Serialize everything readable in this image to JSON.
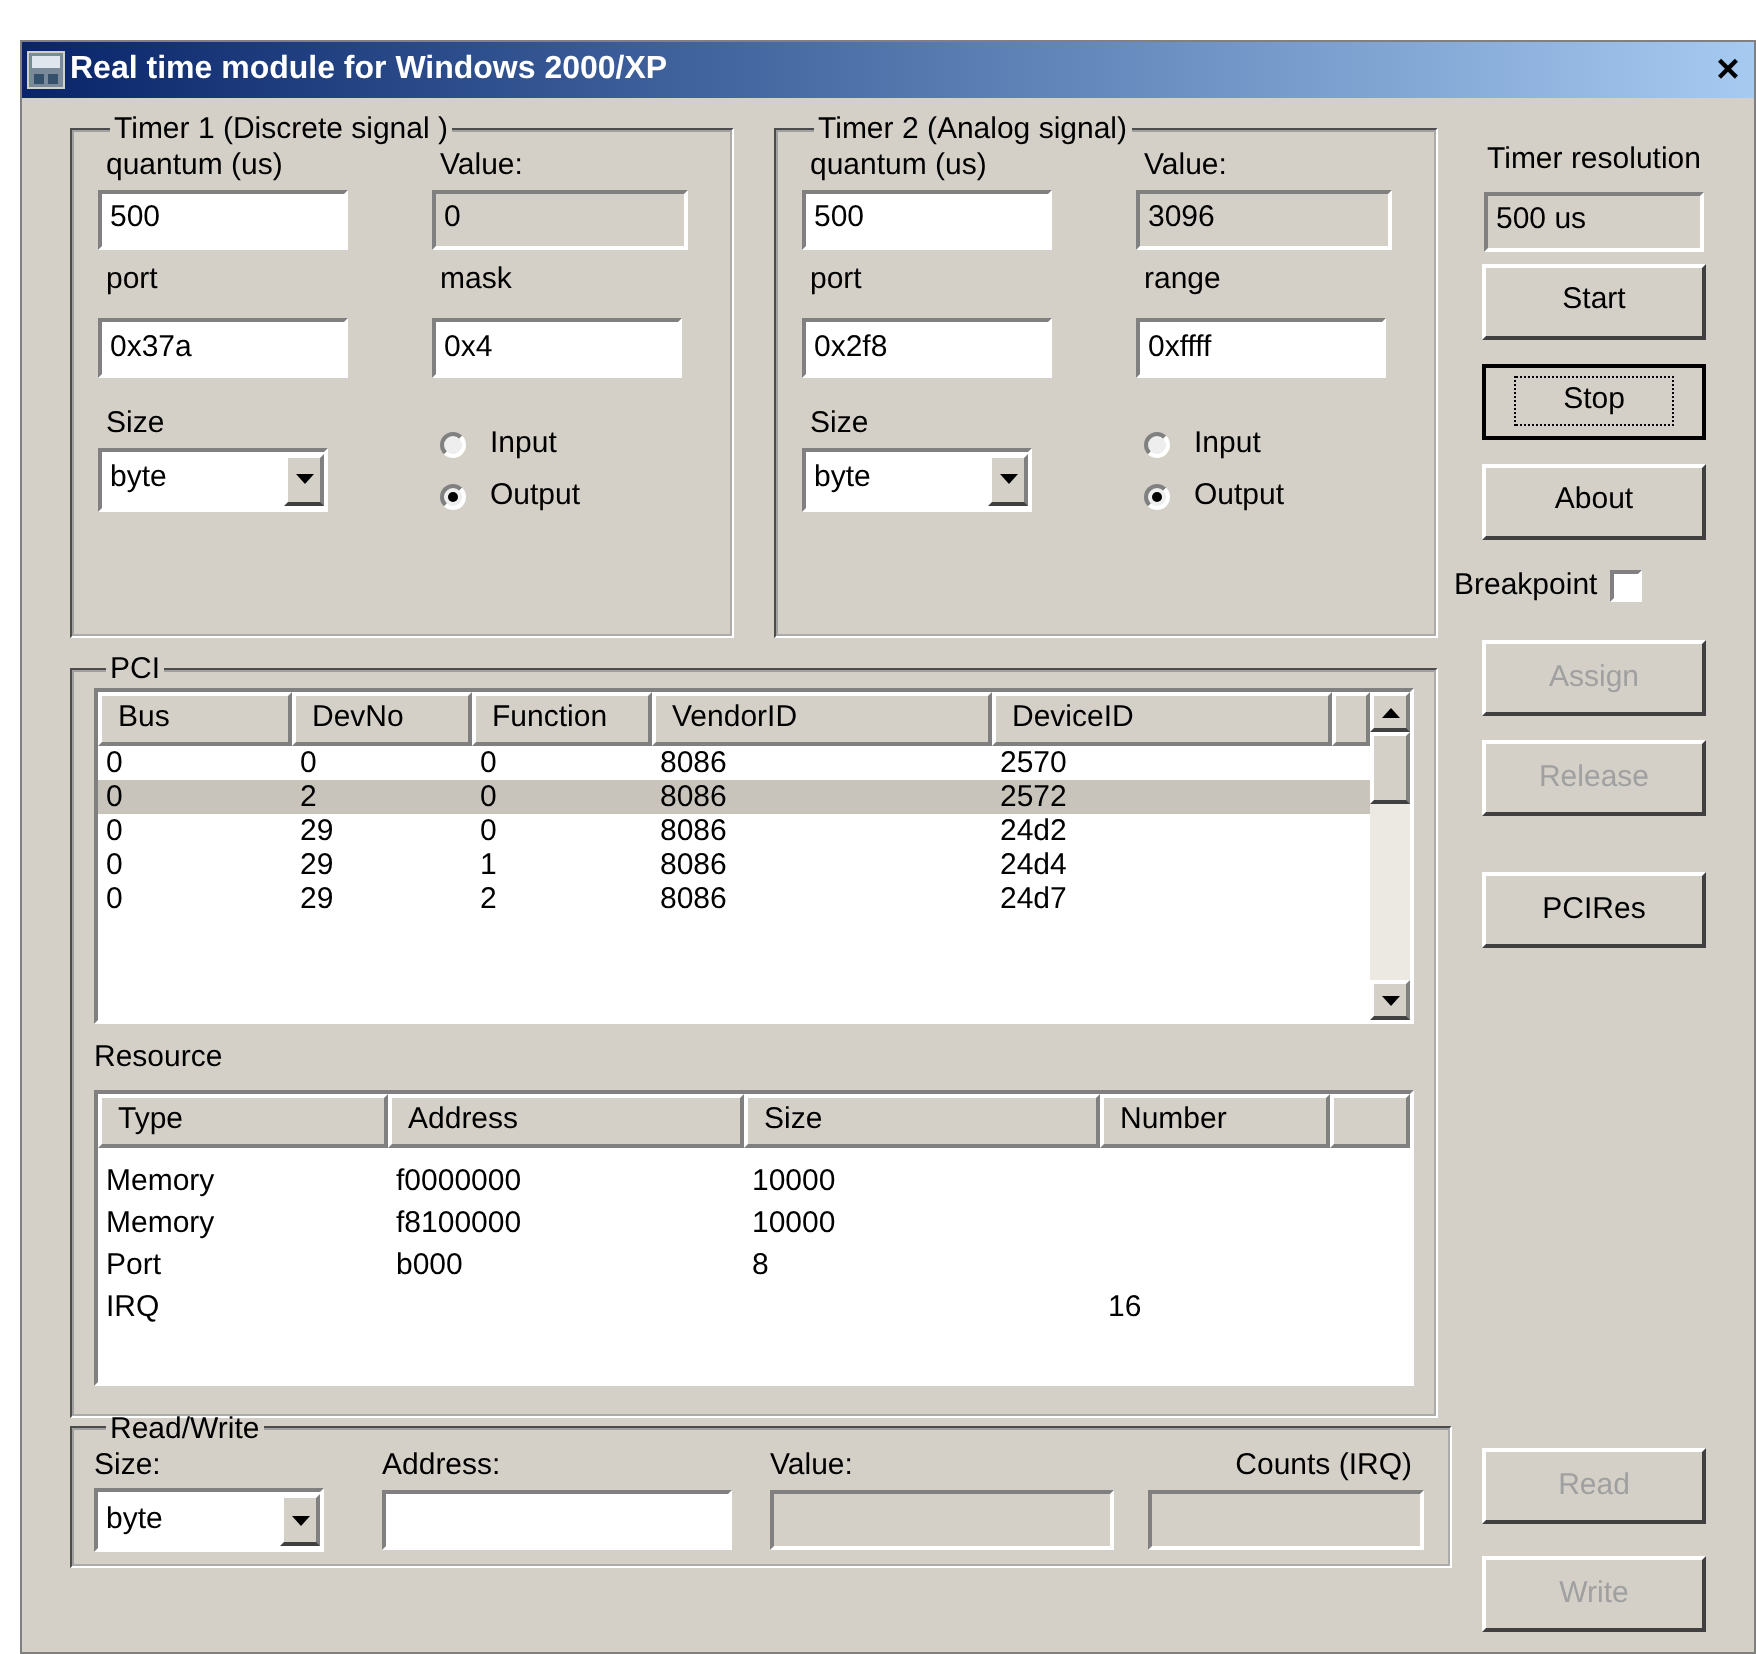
{
  "window": {
    "title": "Real time module for Windows 2000/XP",
    "close": "×"
  },
  "timers": [
    {
      "title": "Timer 1 (Discrete signal )",
      "quantum_label": "quantum (us)",
      "quantum": "500",
      "value_label": "Value:",
      "value": "0",
      "port_label": "port",
      "port": "0x37a",
      "extra_label": "mask",
      "extra": "0x4",
      "size_label": "Size",
      "size": "byte",
      "radios": [
        {
          "label": "Input",
          "selected": false
        },
        {
          "label": "Output",
          "selected": true
        }
      ]
    },
    {
      "title": "Timer 2 (Analog signal)",
      "quantum_label": "quantum (us)",
      "quantum": "500",
      "value_label": "Value:",
      "value": "3096",
      "port_label": "port",
      "port": "0x2f8",
      "extra_label": "range",
      "extra": "0xffff",
      "size_label": "Size",
      "size": "byte",
      "radios": [
        {
          "label": "Input",
          "selected": false
        },
        {
          "label": "Output",
          "selected": true
        }
      ]
    }
  ],
  "timer_resolution": {
    "label": "Timer resolution",
    "value": "500 us"
  },
  "top_buttons": [
    {
      "label": "Start",
      "disabled": false,
      "focused": false
    },
    {
      "label": "Stop",
      "disabled": false,
      "focused": true
    },
    {
      "label": "About",
      "disabled": false,
      "focused": false
    }
  ],
  "breakpoint": {
    "label": "Breakpoint",
    "checked": false
  },
  "pci_buttons": [
    {
      "label": "Assign",
      "disabled": true,
      "focused": false
    },
    {
      "label": "Release",
      "disabled": true,
      "focused": false
    },
    {
      "label": "PCIRes",
      "disabled": false,
      "focused": false
    }
  ],
  "pci": {
    "title": "PCI",
    "columns": [
      "Bus",
      "DevNo",
      "Function",
      "VendorID",
      "DeviceID"
    ],
    "rows": [
      {
        "cells": [
          "0",
          "0",
          "0",
          "8086",
          "2570"
        ],
        "selected": false
      },
      {
        "cells": [
          "0",
          "2",
          "0",
          "8086",
          "2572"
        ],
        "selected": true
      },
      {
        "cells": [
          "0",
          "29",
          "0",
          "8086",
          "24d2"
        ],
        "selected": false
      },
      {
        "cells": [
          "0",
          "29",
          "1",
          "8086",
          "24d4"
        ],
        "selected": false
      },
      {
        "cells": [
          "0",
          "29",
          "2",
          "8086",
          "24d7"
        ],
        "selected": false
      }
    ]
  },
  "resource": {
    "title": "Resource",
    "columns": [
      "Type",
      "Address",
      "Size",
      "Number"
    ],
    "rows": [
      {
        "cells": [
          "Memory",
          "f0000000",
          "10000",
          ""
        ]
      },
      {
        "cells": [
          "Memory",
          "f8100000",
          "10000",
          ""
        ]
      },
      {
        "cells": [
          "Port",
          "b000",
          "8",
          ""
        ]
      },
      {
        "cells": [
          "IRQ",
          "",
          "",
          "16"
        ]
      }
    ]
  },
  "read_write": {
    "title": "Read/Write",
    "size_label": "Size:",
    "size": "byte",
    "address_label": "Address:",
    "value_label": "Value:",
    "counts_label": "Counts (IRQ)"
  },
  "rw_buttons": [
    {
      "label": "Read",
      "disabled": true,
      "focused": false
    },
    {
      "label": "Write",
      "disabled": true,
      "focused": false
    }
  ]
}
